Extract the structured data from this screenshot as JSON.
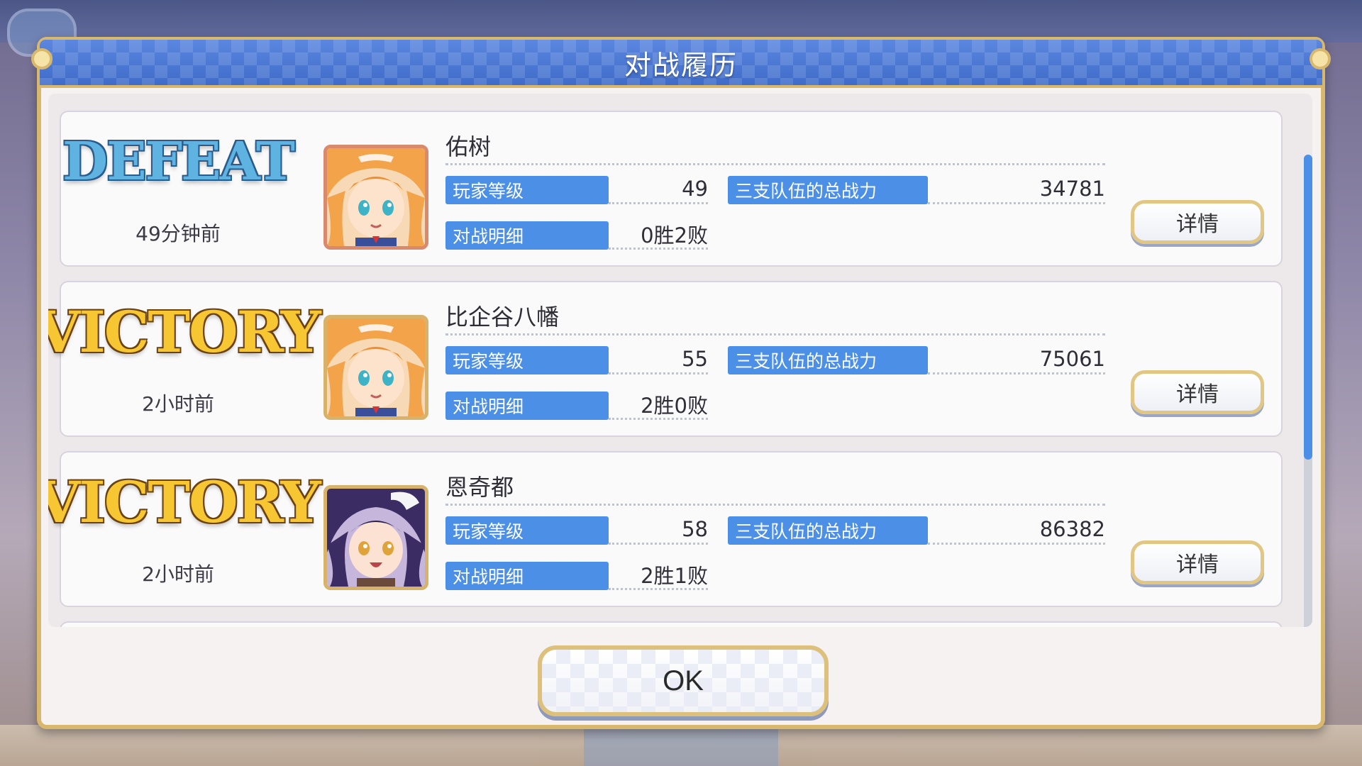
{
  "dialog": {
    "title": "对战履历"
  },
  "labels": {
    "level": "玩家等级",
    "power": "三支队伍的总战力",
    "detail": "对战明细",
    "detail_button": "详情"
  },
  "records": [
    {
      "result": "DEFEAT",
      "result_type": "defeat",
      "time": "49分钟前",
      "name": "佑树",
      "avatar": "orange-haired-character",
      "level": "49",
      "power": "34781",
      "record": "0胜2败"
    },
    {
      "result": "VICTORY",
      "result_type": "victory",
      "time": "2小时前",
      "name": "比企谷八幡",
      "avatar": "orange-haired-character",
      "level": "55",
      "power": "75061",
      "record": "2胜0败"
    },
    {
      "result": "VICTORY",
      "result_type": "victory",
      "time": "2小时前",
      "name": "恩奇都",
      "avatar": "purple-haired-character",
      "level": "58",
      "power": "86382",
      "record": "2胜1败"
    }
  ],
  "ok_button": {
    "label": "OK"
  },
  "colors": {
    "accent_blue": "#4c8fe6",
    "gold_border": "#d7b86d",
    "victory": "#f6c633",
    "defeat": "#5fb3e0"
  }
}
